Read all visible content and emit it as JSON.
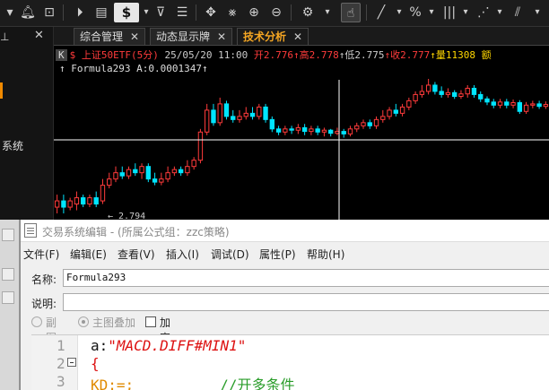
{
  "toolbar": {
    "dollar_label": "$",
    "icons": [
      "tag-icon",
      "bell-icon",
      "chart-icon",
      "play-icon",
      "document-icon",
      "dollar-icon",
      "filter-icon",
      "list-icon",
      "move-icon",
      "grid-icon",
      "zoom-in-icon",
      "zoom-out-icon",
      "gear-icon",
      "hand-icon",
      "line-icon",
      "percent-icon",
      "bars-icon",
      "fan-icon",
      "hatch-icon"
    ]
  },
  "sidebar": {
    "label": "系统"
  },
  "tabs": [
    {
      "label": "综合管理"
    },
    {
      "label": "动态显示牌"
    },
    {
      "label": "技术分析"
    }
  ],
  "chart": {
    "k_badge": "K",
    "symbol": "$ 上证50ETF(5分)",
    "datetime": "25/05/20 11:00",
    "open_label": "开",
    "open": "2.776",
    "high_label": "↑高",
    "high": "2.778",
    "low_label": "↑低",
    "low": "2.775",
    "close_label": "↑收",
    "close": "2.777",
    "vol_label": "↑量",
    "vol": "11308",
    "extra": "额",
    "formula_line": "↑ Formula293 A:0.0001347↑",
    "low_marker": "2.794",
    "colors": {
      "up": "#ff3b3b",
      "down": "#00e5ff",
      "crosshair": "#ffffff"
    }
  },
  "chart_data": {
    "type": "candlestick",
    "title": "上证50ETF(5分)",
    "candles": [
      {
        "o": 2.7635,
        "c": 2.7645,
        "h": 2.7655,
        "l": 2.7625
      },
      {
        "o": 2.7645,
        "c": 2.7635,
        "h": 2.7655,
        "l": 2.7625
      },
      {
        "o": 2.7635,
        "c": 2.7645,
        "h": 2.765,
        "l": 2.763
      },
      {
        "o": 2.764,
        "c": 2.765,
        "h": 2.766,
        "l": 2.763
      },
      {
        "o": 2.765,
        "c": 2.764,
        "h": 2.7655,
        "l": 2.7635
      },
      {
        "o": 2.764,
        "c": 2.765,
        "h": 2.7655,
        "l": 2.7635
      },
      {
        "o": 2.765,
        "c": 2.764,
        "h": 2.766,
        "l": 2.7635
      },
      {
        "o": 2.7645,
        "c": 2.767,
        "h": 2.768,
        "l": 2.764
      },
      {
        "o": 2.767,
        "c": 2.768,
        "h": 2.769,
        "l": 2.7665
      },
      {
        "o": 2.768,
        "c": 2.769,
        "h": 2.77,
        "l": 2.7675
      },
      {
        "o": 2.769,
        "c": 2.7685,
        "h": 2.77,
        "l": 2.768
      },
      {
        "o": 2.7685,
        "c": 2.7695,
        "h": 2.77,
        "l": 2.768
      },
      {
        "o": 2.7695,
        "c": 2.769,
        "h": 2.7705,
        "l": 2.7685
      },
      {
        "o": 2.769,
        "c": 2.77,
        "h": 2.7705,
        "l": 2.768
      },
      {
        "o": 2.77,
        "c": 2.768,
        "h": 2.7705,
        "l": 2.7675
      },
      {
        "o": 2.768,
        "c": 2.7675,
        "h": 2.769,
        "l": 2.767
      },
      {
        "o": 2.7675,
        "c": 2.768,
        "h": 2.769,
        "l": 2.767
      },
      {
        "o": 2.768,
        "c": 2.769,
        "h": 2.77,
        "l": 2.7675
      },
      {
        "o": 2.769,
        "c": 2.7695,
        "h": 2.77,
        "l": 2.7685
      },
      {
        "o": 2.7695,
        "c": 2.769,
        "h": 2.77,
        "l": 2.7685
      },
      {
        "o": 2.769,
        "c": 2.77,
        "h": 2.771,
        "l": 2.7685
      },
      {
        "o": 2.77,
        "c": 2.771,
        "h": 2.7715,
        "l": 2.7695
      },
      {
        "o": 2.771,
        "c": 2.7755,
        "h": 2.776,
        "l": 2.7705
      },
      {
        "o": 2.7755,
        "c": 2.779,
        "h": 2.78,
        "l": 2.775
      },
      {
        "o": 2.779,
        "c": 2.777,
        "h": 2.78,
        "l": 2.7765
      },
      {
        "o": 2.777,
        "c": 2.78,
        "h": 2.781,
        "l": 2.7765
      },
      {
        "o": 2.78,
        "c": 2.778,
        "h": 2.7805,
        "l": 2.7775
      },
      {
        "o": 2.778,
        "c": 2.7775,
        "h": 2.779,
        "l": 2.777
      },
      {
        "o": 2.7775,
        "c": 2.778,
        "h": 2.779,
        "l": 2.777
      },
      {
        "o": 2.778,
        "c": 2.7785,
        "h": 2.7795,
        "l": 2.7775
      },
      {
        "o": 2.7785,
        "c": 2.778,
        "h": 2.7795,
        "l": 2.7775
      },
      {
        "o": 2.778,
        "c": 2.7795,
        "h": 2.78,
        "l": 2.7775
      },
      {
        "o": 2.7795,
        "c": 2.7775,
        "h": 2.78,
        "l": 2.777
      },
      {
        "o": 2.7775,
        "c": 2.776,
        "h": 2.778,
        "l": 2.7755
      },
      {
        "o": 2.776,
        "c": 2.7755,
        "h": 2.7765,
        "l": 2.775
      },
      {
        "o": 2.7755,
        "c": 2.776,
        "h": 2.7765,
        "l": 2.775
      },
      {
        "o": 2.776,
        "c": 2.7758,
        "h": 2.7765,
        "l": 2.7752
      },
      {
        "o": 2.7758,
        "c": 2.7762,
        "h": 2.7768,
        "l": 2.7752
      },
      {
        "o": 2.7762,
        "c": 2.7756,
        "h": 2.7768,
        "l": 2.775
      },
      {
        "o": 2.7756,
        "c": 2.776,
        "h": 2.7765,
        "l": 2.775
      },
      {
        "o": 2.776,
        "c": 2.7755,
        "h": 2.7765,
        "l": 2.775
      },
      {
        "o": 2.7755,
        "c": 2.7758,
        "h": 2.7762,
        "l": 2.7748
      },
      {
        "o": 2.7758,
        "c": 2.7753,
        "h": 2.776,
        "l": 2.7748
      },
      {
        "o": 2.7753,
        "c": 2.7756,
        "h": 2.7762,
        "l": 2.775
      },
      {
        "o": 2.7756,
        "c": 2.7752,
        "h": 2.776,
        "l": 2.7746
      },
      {
        "o": 2.7752,
        "c": 2.776,
        "h": 2.7765,
        "l": 2.7748
      },
      {
        "o": 2.776,
        "c": 2.7765,
        "h": 2.777,
        "l": 2.7755
      },
      {
        "o": 2.7765,
        "c": 2.777,
        "h": 2.7775,
        "l": 2.776
      },
      {
        "o": 2.777,
        "c": 2.7765,
        "h": 2.7775,
        "l": 2.776
      },
      {
        "o": 2.7765,
        "c": 2.7775,
        "h": 2.778,
        "l": 2.776
      },
      {
        "o": 2.7775,
        "c": 2.778,
        "h": 2.779,
        "l": 2.777
      },
      {
        "o": 2.778,
        "c": 2.779,
        "h": 2.7795,
        "l": 2.7775
      },
      {
        "o": 2.779,
        "c": 2.7785,
        "h": 2.78,
        "l": 2.778
      },
      {
        "o": 2.7785,
        "c": 2.7795,
        "h": 2.78,
        "l": 2.778
      },
      {
        "o": 2.7795,
        "c": 2.7805,
        "h": 2.781,
        "l": 2.779
      },
      {
        "o": 2.7805,
        "c": 2.7815,
        "h": 2.782,
        "l": 2.78
      },
      {
        "o": 2.7815,
        "c": 2.782,
        "h": 2.783,
        "l": 2.781
      },
      {
        "o": 2.782,
        "c": 2.783,
        "h": 2.784,
        "l": 2.7815
      },
      {
        "o": 2.783,
        "c": 2.782,
        "h": 2.7835,
        "l": 2.7815
      },
      {
        "o": 2.782,
        "c": 2.7815,
        "h": 2.7828,
        "l": 2.781
      },
      {
        "o": 2.7815,
        "c": 2.7818,
        "h": 2.7825,
        "l": 2.781
      },
      {
        "o": 2.7818,
        "c": 2.7812,
        "h": 2.7822,
        "l": 2.7808
      },
      {
        "o": 2.7812,
        "c": 2.7816,
        "h": 2.7822,
        "l": 2.7808
      },
      {
        "o": 2.7816,
        "c": 2.7825,
        "h": 2.783,
        "l": 2.781
      },
      {
        "o": 2.7825,
        "c": 2.7815,
        "h": 2.783,
        "l": 2.781
      },
      {
        "o": 2.7815,
        "c": 2.7808,
        "h": 2.782,
        "l": 2.7803
      },
      {
        "o": 2.7808,
        "c": 2.7803,
        "h": 2.7812,
        "l": 2.7798
      },
      {
        "o": 2.7803,
        "c": 2.7798,
        "h": 2.7808,
        "l": 2.7793
      },
      {
        "o": 2.7798,
        "c": 2.7803,
        "h": 2.7808,
        "l": 2.7793
      },
      {
        "o": 2.7803,
        "c": 2.7798,
        "h": 2.7808,
        "l": 2.7793
      },
      {
        "o": 2.7798,
        "c": 2.7802,
        "h": 2.7807,
        "l": 2.7793
      },
      {
        "o": 2.7802,
        "c": 2.7788,
        "h": 2.7806,
        "l": 2.7784
      },
      {
        "o": 2.7788,
        "c": 2.7798,
        "h": 2.7803,
        "l": 2.7784
      },
      {
        "o": 2.7798,
        "c": 2.78,
        "h": 2.7805,
        "l": 2.7793
      },
      {
        "o": 2.78,
        "c": 2.7796,
        "h": 2.7805,
        "l": 2.7792
      },
      {
        "o": 2.7796,
        "c": 2.7799,
        "h": 2.7804,
        "l": 2.7792
      }
    ],
    "ylim": [
      2.7615,
      2.785
    ]
  },
  "editor": {
    "title": "交易系统编辑 - (所属公式组：zzc策略)",
    "menus": [
      "文件(F)",
      "编辑(E)",
      "查看(V)",
      "插入(I)",
      "调试(D)",
      "属性(P)",
      "帮助(H)"
    ],
    "name_label": "名称:",
    "name_value": "Formula293",
    "desc_label": "说明:",
    "desc_value": "",
    "radio1": "副图",
    "radio2": "主图叠加",
    "check": "加密",
    "lines": [
      {
        "no": "1",
        "a": "a:",
        "b": "\"MACD.DIFF#MIN1\""
      },
      {
        "no": "2",
        "a": "{",
        "b": ""
      },
      {
        "no": "3",
        "a": "KD:=;",
        "b": "//开多条件"
      }
    ]
  }
}
